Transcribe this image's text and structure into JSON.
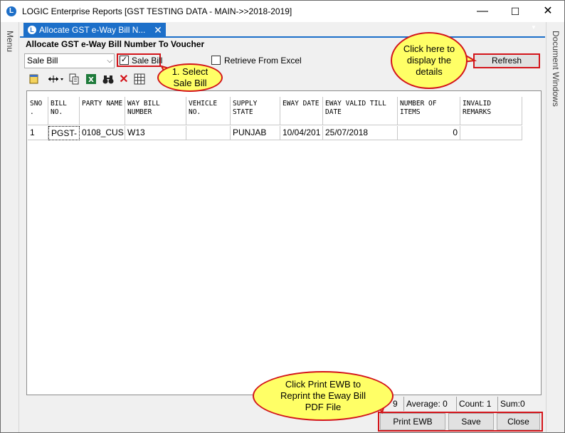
{
  "window": {
    "title": "LOGIC Enterprise Reports  [GST TESTING DATA - MAIN->>2018-2019]",
    "minimize": "—",
    "maximize": "☐",
    "close": "✕"
  },
  "side": {
    "left_label": "Menu",
    "right_label": "Document Windows"
  },
  "tab": {
    "label": "Allocate GST e-Way Bill N...",
    "close": "✕"
  },
  "form": {
    "heading": "Allocate GST e-Way Bill Number To Voucher",
    "bill_type": {
      "value": "Sale Bill"
    },
    "sale_bill_checkbox": {
      "label": "Sale Bill",
      "checked": true
    },
    "retrieve_checkbox": {
      "label": "Retrieve From Excel",
      "checked": false
    },
    "refresh_label": "Refresh"
  },
  "toolbar_icons": [
    "note-icon",
    "column-resize-icon",
    "copy-icon",
    "excel-icon",
    "binoculars-icon",
    "delete-icon",
    "grid-icon"
  ],
  "grid": {
    "headers": [
      "SNO .",
      "BILL NO.",
      "PARTY NAME",
      "WAY BILL NUMBER",
      "VEHICLE NO.",
      "SUPPLY STATE",
      "EWAY DATE",
      "EWAY VALID TILL DATE",
      "NUMBER OF ITEMS",
      "INVALID REMARKS"
    ],
    "rows": [
      [
        "1",
        "PGST-",
        "0108_CUS",
        "W13",
        "",
        "PUNJAB",
        "10/04/201",
        "25/07/2018",
        "0",
        ""
      ]
    ]
  },
  "status": {
    "count_partial": "9",
    "average": "Average: 0",
    "count": "Count: 1",
    "sum": "Sum:0"
  },
  "buttons": {
    "print_ewb": "Print EWB",
    "save": "Save",
    "close": "Close"
  },
  "callouts": {
    "select_sale_bill": "1. Select Sale Bill",
    "refresh_hint": "Click here to display the details",
    "print_hint": "Click Print EWB to Reprint the Eway Bill PDF File"
  },
  "colors": {
    "accent": "#1c6fc9",
    "highlight": "#d3141a",
    "callout_fill": "#ffff66"
  }
}
